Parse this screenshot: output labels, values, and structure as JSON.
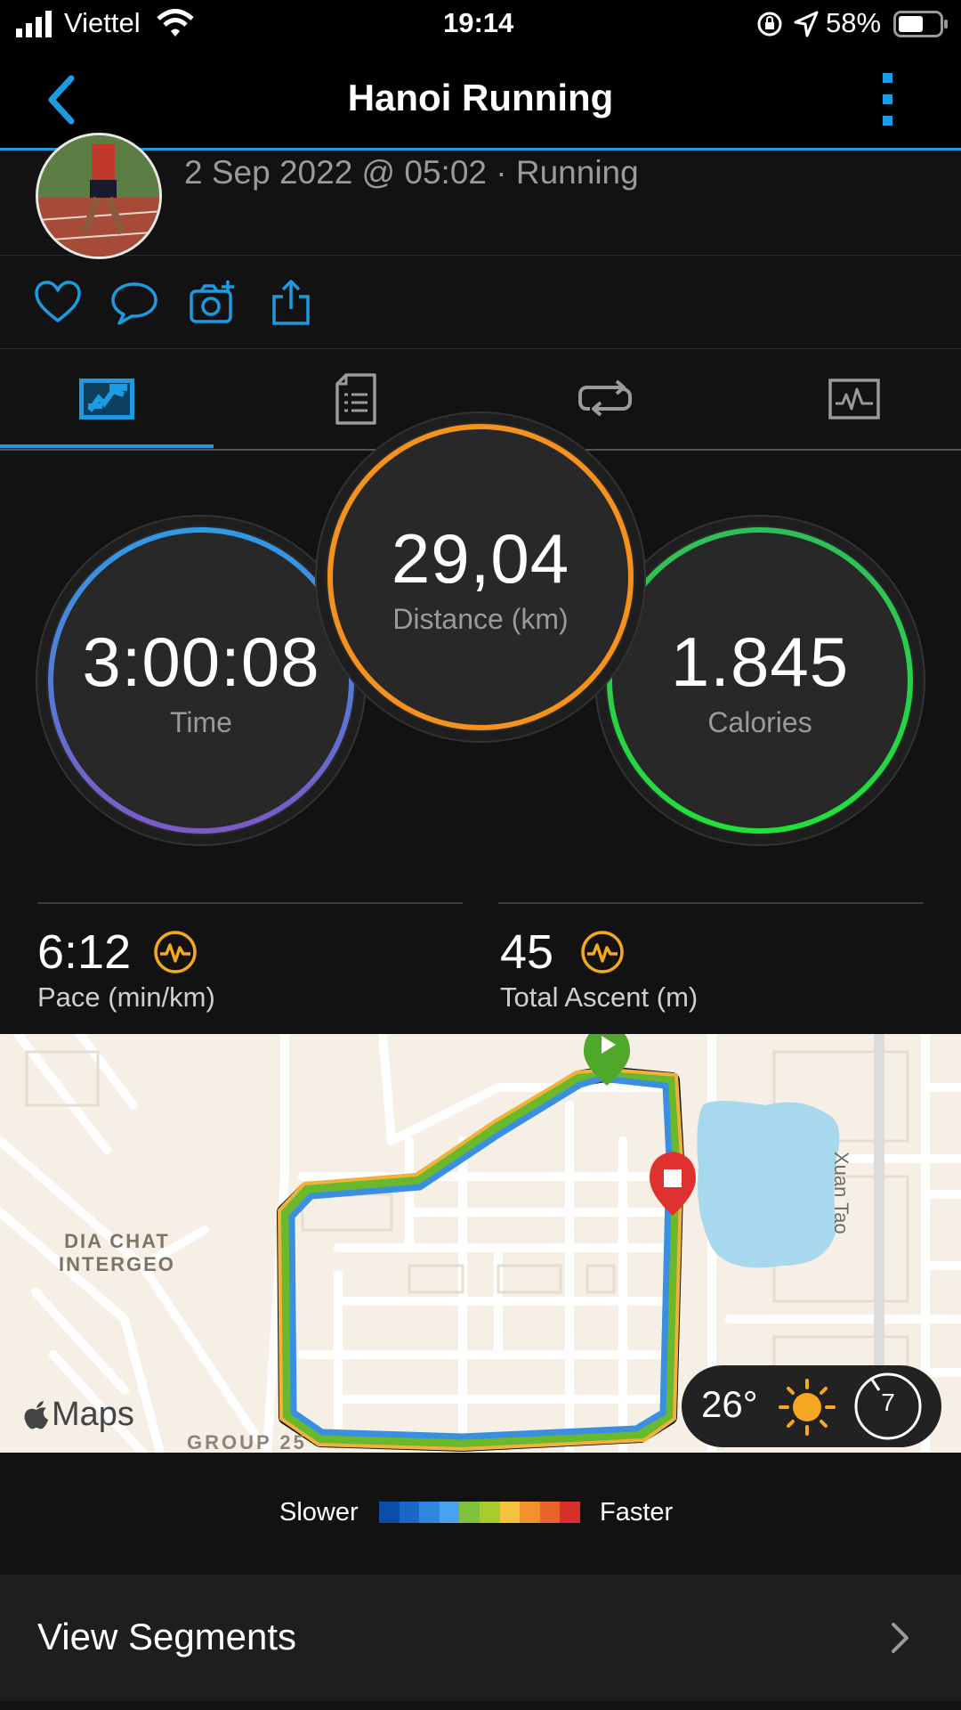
{
  "status_bar": {
    "carrier": "Viettel",
    "time": "19:14",
    "battery": "58%",
    "icons": [
      "signal-icon",
      "wifi-icon",
      "rotation-lock-icon",
      "location-arrow-icon",
      "battery-icon"
    ]
  },
  "header": {
    "title": "Hanoi Running",
    "back_icon": "chevron-left-icon",
    "menu_icon": "more-vertical-icon"
  },
  "activity": {
    "date_line": "2 Sep 2022 @ 05:02 · Running"
  },
  "actions": [
    "heart-icon",
    "comment-icon",
    "add-photo-icon",
    "share-icon"
  ],
  "tabs": [
    "stats-tab",
    "details-tab",
    "laps-tab",
    "charts-tab"
  ],
  "summary": {
    "time": {
      "value": "3:00:08",
      "label": "Time"
    },
    "distance": {
      "value": "29,04",
      "label": "Distance (km)"
    },
    "calories": {
      "value": "1.845",
      "label": "Calories"
    }
  },
  "stats": {
    "pace": {
      "value": "6:12",
      "label": "Pace (min/km)"
    },
    "ascent": {
      "value": "45",
      "label": "Total Ascent (m)"
    }
  },
  "map": {
    "labels": {
      "area1_line1": "DIA CHAT",
      "area1_line2": "INTERGEO",
      "area2": "GROUP 25",
      "street": "Xuan Tao",
      "attribution": "Maps"
    },
    "weather": {
      "temp": "26°",
      "badge": "7"
    }
  },
  "legend": {
    "slower": "Slower",
    "faster": "Faster",
    "colors": [
      "#0a4ea8",
      "#1867c9",
      "#2f86df",
      "#4aa1ee",
      "#7fc23c",
      "#a8cc2e",
      "#f5c23e",
      "#f2922e",
      "#e8642a",
      "#d6302a"
    ]
  },
  "segments": {
    "label": "View Segments"
  },
  "colors": {
    "accent": "#1d9be0",
    "time_ring": "#3b8fe0",
    "distance_ring": "#f5921e",
    "calories_ring": "#22d13c",
    "stat_icon": "#f5a623"
  }
}
